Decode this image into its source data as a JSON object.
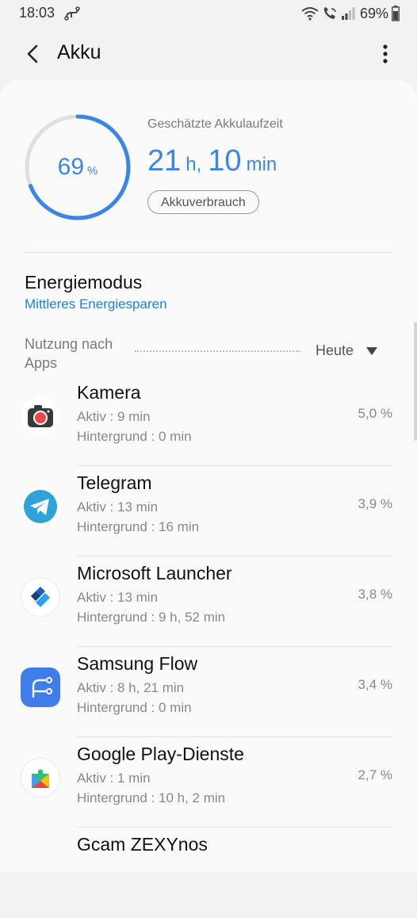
{
  "status_bar": {
    "time": "18:03",
    "battery_pct": "69%",
    "icons": [
      "link-icon",
      "wifi-icon",
      "wifi-calling-icon",
      "signal-icon",
      "battery-icon"
    ]
  },
  "header": {
    "title": "Akku"
  },
  "battery": {
    "level": 69,
    "level_num": "69",
    "level_unit": "%",
    "estimate_label": "Geschätzte Akkulaufzeit",
    "estimate_hours": "21",
    "estimate_hours_unit": "h,",
    "estimate_minutes": "10",
    "estimate_minutes_unit": "min",
    "usage_button": "Akkuverbrauch",
    "ring_color": "#3a86e6"
  },
  "energy_mode": {
    "title": "Energiemodus",
    "value": "Mittleres Energiesparen"
  },
  "usage": {
    "label_line1": "Nutzung nach",
    "label_line2": "Apps",
    "period": "Heute",
    "apps": [
      {
        "name": "Kamera",
        "active": "Aktiv : 9 min",
        "background": "Hintergrund : 0 min",
        "percent": "5,0 %",
        "icon": "camera-app-icon"
      },
      {
        "name": "Telegram",
        "active": "Aktiv : 13 min",
        "background": "Hintergrund : 16 min",
        "percent": "3,9 %",
        "icon": "telegram-app-icon"
      },
      {
        "name": "Microsoft Launcher",
        "active": "Aktiv : 13 min",
        "background": "Hintergrund : 9 h, 52 min",
        "percent": "3,8 %",
        "icon": "microsoft-launcher-app-icon"
      },
      {
        "name": "Samsung Flow",
        "active": "Aktiv : 8 h, 21 min",
        "background": "Hintergrund : 0 min",
        "percent": "3,4 %",
        "icon": "samsung-flow-app-icon"
      },
      {
        "name": "Google Play-Dienste",
        "active": "Aktiv : 1 min",
        "background": "Hintergrund : 10 h, 2 min",
        "percent": "2,7 %",
        "icon": "google-play-services-app-icon"
      },
      {
        "name": "Gcam ZEXYnos",
        "active": "",
        "background": "",
        "percent": "",
        "icon": "gcam-app-icon"
      }
    ]
  }
}
